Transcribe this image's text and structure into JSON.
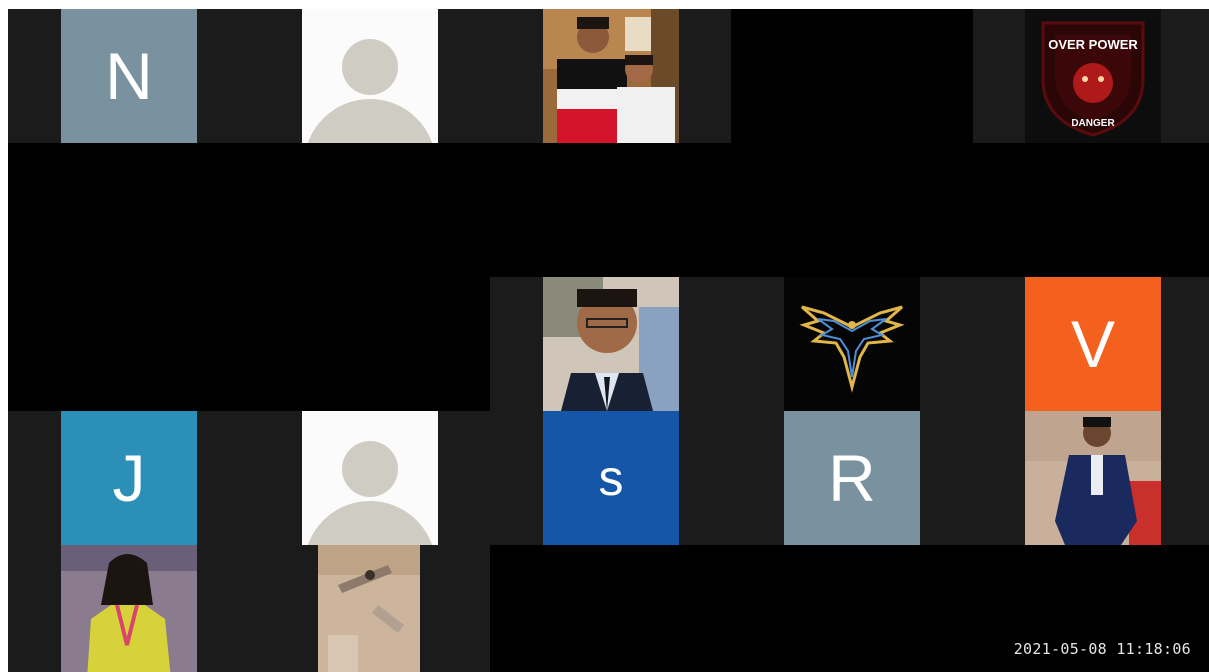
{
  "participants": {
    "row1": [
      {
        "initial": "N",
        "color": "#7a929f"
      },
      {
        "type": "default-avatar"
      },
      {
        "type": "photo",
        "desc_name": "couple-photo"
      },
      {
        "type": "empty"
      },
      {
        "type": "logo",
        "text": "OVER POWER",
        "subtext": "DANGER"
      }
    ],
    "row3": [
      {
        "type": "photo",
        "desc_name": "man-photo"
      },
      {
        "type": "logo",
        "desc_name": "phoenix-logo"
      },
      {
        "initial": "V",
        "color": "#f4601e"
      }
    ],
    "row4": [
      {
        "initial": "J",
        "color": "#2c8fb8"
      },
      {
        "type": "default-avatar"
      },
      {
        "initial": "S",
        "display": "s",
        "color": "#1556a8"
      },
      {
        "initial": "R",
        "color": "#7a929f"
      },
      {
        "type": "photo",
        "desc_name": "man-suit-photo"
      }
    ]
  },
  "tile_letters": {
    "n": "N",
    "v": "V",
    "j": "J",
    "s": "s",
    "r": "R"
  },
  "logo_text": {
    "over_power": "OVER POWER",
    "danger": "DANGER"
  },
  "timestamp": "2021-05-08  11:18:06",
  "colors": {
    "background": "#000000",
    "cell": "#1b1b1b",
    "tile_n": "#7a929f",
    "tile_v": "#f4601e",
    "tile_j": "#2c8fb8",
    "tile_s": "#1556a8",
    "tile_r": "#7a929f"
  }
}
